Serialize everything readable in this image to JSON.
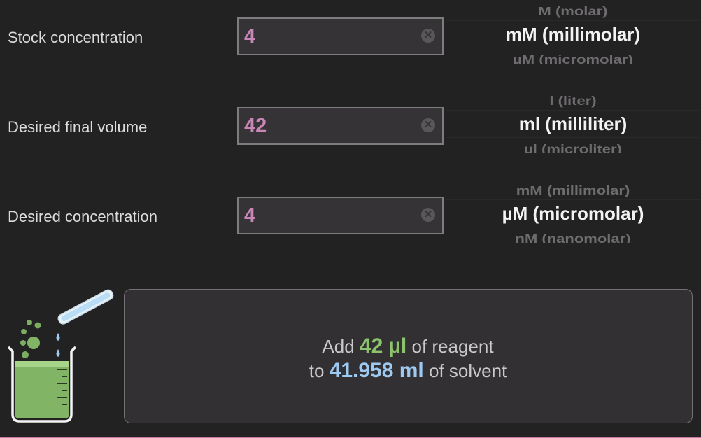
{
  "rows": [
    {
      "label": "Stock concentration",
      "value": "4",
      "unit_prev": "M (molar)",
      "unit_selected": "mM (millimolar)",
      "unit_next": "µM (micromolar)"
    },
    {
      "label": "Desired final volume",
      "value": "42",
      "unit_prev": "l (liter)",
      "unit_selected": "ml (milliliter)",
      "unit_next": "µl (microliter)"
    },
    {
      "label": "Desired concentration",
      "value": "4",
      "unit_prev": "mM (millimolar)",
      "unit_selected": "µM (micromolar)",
      "unit_next": "nM (nanomolar)"
    }
  ],
  "clear_glyph": "✕",
  "result": {
    "line1_prefix": "Add",
    "reagent_amount": "42 µl",
    "line1_suffix": "of reagent",
    "line2_prefix": "to",
    "solvent_amount": "41.958 ml",
    "line2_suffix": "of solvent"
  },
  "colors": {
    "background": "#232223",
    "input_text": "#c886b6",
    "reagent_amount": "#8cc46d",
    "solvent_amount": "#9dcaf2",
    "window_border_accent": "#c47aa2"
  },
  "icons": {
    "clear": "clear-circle-icon",
    "logo": "beaker-pipette-icon"
  }
}
